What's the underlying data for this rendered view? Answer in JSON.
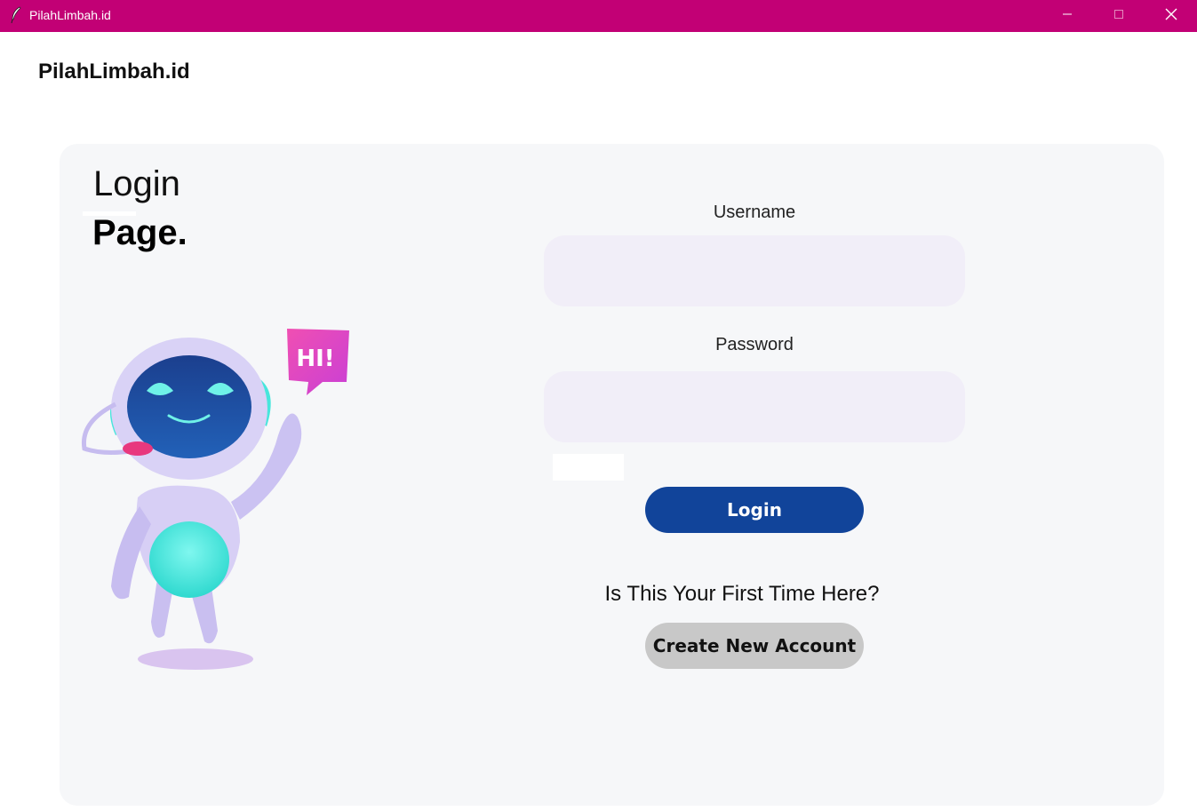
{
  "window": {
    "title": "PilahLimbah.id",
    "titlebar_color": "#c20075"
  },
  "header": {
    "brand": "PilahLimbah.id"
  },
  "panel": {
    "heading_line1": "Login",
    "heading_line2": "Page.",
    "illustration_bubble": "HI!"
  },
  "form": {
    "username_label": "Username",
    "username_value": "",
    "password_label": "Password",
    "password_value": "",
    "login_button": "Login",
    "first_time_text": "Is This Your First Time Here?",
    "create_button": "Create New Account"
  },
  "colors": {
    "accent_magenta": "#c20075",
    "login_button": "#11449a",
    "create_button": "#c8c8c8",
    "field_bg": "#f1eef8",
    "panel_bg": "#f6f7f9"
  },
  "icons": {
    "app": "feather-icon",
    "minimize": "minimize-icon",
    "maximize": "maximize-icon",
    "close": "close-icon"
  }
}
